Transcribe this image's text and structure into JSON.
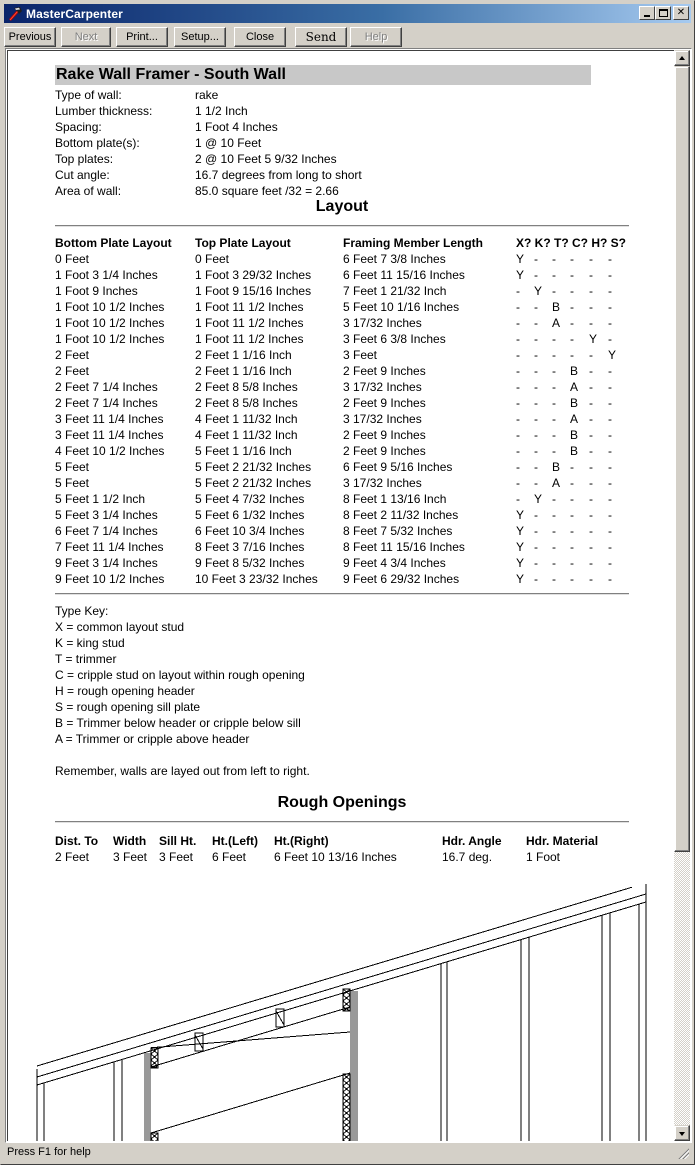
{
  "window": {
    "title": "MasterCarpenter",
    "controls": {
      "minimize": "_",
      "maximize": "□",
      "close": "✕"
    }
  },
  "toolbar": {
    "buttons": [
      {
        "label": "Previous",
        "enabled": true
      },
      {
        "label": "Next",
        "enabled": false
      },
      {
        "label": "Print...",
        "enabled": true
      },
      {
        "label": "Setup...",
        "enabled": true
      },
      {
        "label": "Close",
        "enabled": true
      },
      {
        "label": "Send",
        "enabled": true
      },
      {
        "label": "Help",
        "enabled": false
      }
    ]
  },
  "report": {
    "title": "Rake Wall Framer - South Wall",
    "info": [
      {
        "label": "Type of wall:",
        "value": "rake"
      },
      {
        "label": "Lumber thickness:",
        "value": "1 1/2 Inch"
      },
      {
        "label": "Spacing:",
        "value": "1 Foot 4 Inches"
      },
      {
        "label": "Bottom plate(s):",
        "value": "1 @ 10 Feet"
      },
      {
        "label": "Top plates:",
        "value": "2 @ 10 Feet 5 9/32 Inches"
      },
      {
        "label": "Cut angle:",
        "value": "16.7 degrees from long to short"
      },
      {
        "label": "Area of wall:",
        "value": "85.0 square feet /32 = 2.66"
      }
    ],
    "layout": {
      "heading": "Layout",
      "columns": {
        "bottom": "Bottom Plate Layout",
        "top": "Top Plate Layout",
        "framing": "Framing Member Length",
        "flags": "X? K? T? C? H? S?"
      },
      "rows": [
        {
          "bottom": "0 Feet",
          "top": "0 Feet",
          "framing": "6 Feet 7 3/8 Inches",
          "flags": [
            "Y",
            "-",
            "-",
            "-",
            "-",
            "-"
          ]
        },
        {
          "bottom": "1 Foot 3 1/4 Inches",
          "top": "1 Foot 3 29/32 Inches",
          "framing": "6 Feet 11 15/16 Inches",
          "flags": [
            "Y",
            "-",
            "-",
            "-",
            "-",
            "-"
          ]
        },
        {
          "bottom": "1 Foot 9 Inches",
          "top": "1 Foot 9 15/16 Inches",
          "framing": "7 Feet 1 21/32 Inch",
          "flags": [
            "-",
            "Y",
            "-",
            "-",
            "-",
            "-"
          ]
        },
        {
          "bottom": "1 Foot 10 1/2 Inches",
          "top": "1 Foot 11 1/2 Inches",
          "framing": "5 Feet 10 1/16 Inches",
          "flags": [
            "-",
            "-",
            "B",
            "-",
            "-",
            "-"
          ]
        },
        {
          "bottom": "1 Foot 10 1/2 Inches",
          "top": "1 Foot 11 1/2 Inches",
          "framing": "3 17/32 Inches",
          "flags": [
            "-",
            "-",
            "A",
            "-",
            "-",
            "-"
          ]
        },
        {
          "bottom": "1 Foot 10 1/2 Inches",
          "top": "1 Foot 11 1/2 Inches",
          "framing": "3 Feet 6 3/8 Inches",
          "flags": [
            "-",
            "-",
            "-",
            "-",
            "Y",
            "-"
          ]
        },
        {
          "bottom": "2 Feet",
          "top": "2 Feet 1 1/16 Inch",
          "framing": "3 Feet",
          "flags": [
            "-",
            "-",
            "-",
            "-",
            "-",
            "Y"
          ]
        },
        {
          "bottom": "2 Feet",
          "top": "2 Feet 1 1/16 Inch",
          "framing": "2 Feet 9 Inches",
          "flags": [
            "-",
            "-",
            "-",
            "B",
            "-",
            "-"
          ]
        },
        {
          "bottom": "2 Feet 7 1/4 Inches",
          "top": "2 Feet 8 5/8 Inches",
          "framing": "3 17/32 Inches",
          "flags": [
            "-",
            "-",
            "-",
            "A",
            "-",
            "-"
          ]
        },
        {
          "bottom": "2 Feet 7 1/4 Inches",
          "top": "2 Feet 8 5/8 Inches",
          "framing": "2 Feet 9 Inches",
          "flags": [
            "-",
            "-",
            "-",
            "B",
            "-",
            "-"
          ]
        },
        {
          "bottom": "3 Feet 11 1/4 Inches",
          "top": "4 Feet 1 11/32 Inch",
          "framing": "3 17/32 Inches",
          "flags": [
            "-",
            "-",
            "-",
            "A",
            "-",
            "-"
          ]
        },
        {
          "bottom": "3 Feet 11 1/4 Inches",
          "top": "4 Feet 1 11/32 Inch",
          "framing": "2 Feet 9 Inches",
          "flags": [
            "-",
            "-",
            "-",
            "B",
            "-",
            "-"
          ]
        },
        {
          "bottom": "4 Feet 10 1/2 Inches",
          "top": "5 Feet 1 1/16 Inch",
          "framing": "2 Feet 9 Inches",
          "flags": [
            "-",
            "-",
            "-",
            "B",
            "-",
            "-"
          ]
        },
        {
          "bottom": "5 Feet",
          "top": "5 Feet 2 21/32 Inches",
          "framing": "6 Feet 9 5/16 Inches",
          "flags": [
            "-",
            "-",
            "B",
            "-",
            "-",
            "-"
          ]
        },
        {
          "bottom": "5 Feet",
          "top": "5 Feet 2 21/32 Inches",
          "framing": "3 17/32 Inches",
          "flags": [
            "-",
            "-",
            "A",
            "-",
            "-",
            "-"
          ]
        },
        {
          "bottom": "5 Feet 1 1/2 Inch",
          "top": "5 Feet 4 7/32 Inches",
          "framing": "8 Feet 1 13/16 Inch",
          "flags": [
            "-",
            "Y",
            "-",
            "-",
            "-",
            "-"
          ]
        },
        {
          "bottom": "5 Feet 3 1/4 Inches",
          "top": "5 Feet 6 1/32 Inches",
          "framing": "8 Feet 2 11/32 Inches",
          "flags": [
            "Y",
            "-",
            "-",
            "-",
            "-",
            "-"
          ]
        },
        {
          "bottom": "6 Feet 7 1/4 Inches",
          "top": "6 Feet 10 3/4 Inches",
          "framing": "8 Feet 7 5/32 Inches",
          "flags": [
            "Y",
            "-",
            "-",
            "-",
            "-",
            "-"
          ]
        },
        {
          "bottom": "7 Feet 11 1/4 Inches",
          "top": "8 Feet 3 7/16 Inches",
          "framing": "8 Feet 11 15/16 Inches",
          "flags": [
            "Y",
            "-",
            "-",
            "-",
            "-",
            "-"
          ]
        },
        {
          "bottom": "9 Feet 3 1/4 Inches",
          "top": "9 Feet 8 5/32 Inches",
          "framing": "9 Feet 4 3/4 Inches",
          "flags": [
            "Y",
            "-",
            "-",
            "-",
            "-",
            "-"
          ]
        },
        {
          "bottom": "9 Feet 10 1/2 Inches",
          "top": "10 Feet 3 23/32 Inches",
          "framing": "9 Feet 6 29/32 Inches",
          "flags": [
            "Y",
            "-",
            "-",
            "-",
            "-",
            "-"
          ]
        }
      ]
    },
    "type_key": {
      "heading": "Type Key:",
      "items": [
        "X = common layout stud",
        "K = king stud",
        "T = trimmer",
        "C = cripple stud on layout within rough opening",
        "H = rough opening header",
        "S = rough opening sill plate",
        "B = Trimmer below header or cripple below sill",
        "A = Trimmer or cripple above header"
      ],
      "note": "Remember, walls are layed out from left to right."
    },
    "rough_openings": {
      "heading": "Rough Openings",
      "columns": [
        "Dist. To",
        "Width",
        "Sill Ht.",
        "Ht.(Left)",
        "Ht.(Right)",
        "Hdr. Angle",
        "Hdr. Material"
      ],
      "rows": [
        [
          "2 Feet",
          "3 Feet",
          "3 Feet",
          "6 Feet",
          "6 Feet 10 13/16 Inches",
          "16.7 deg.",
          "1 Foot"
        ]
      ]
    }
  },
  "status_bar": {
    "text": "Press F1 for help"
  },
  "colors": {
    "title_bar_start": "#0a246a",
    "title_bar_end": "#a6caf0",
    "chrome": "#d4d0c8",
    "report_title_bg": "#c8c8c8",
    "opening_stud": "#999999"
  }
}
